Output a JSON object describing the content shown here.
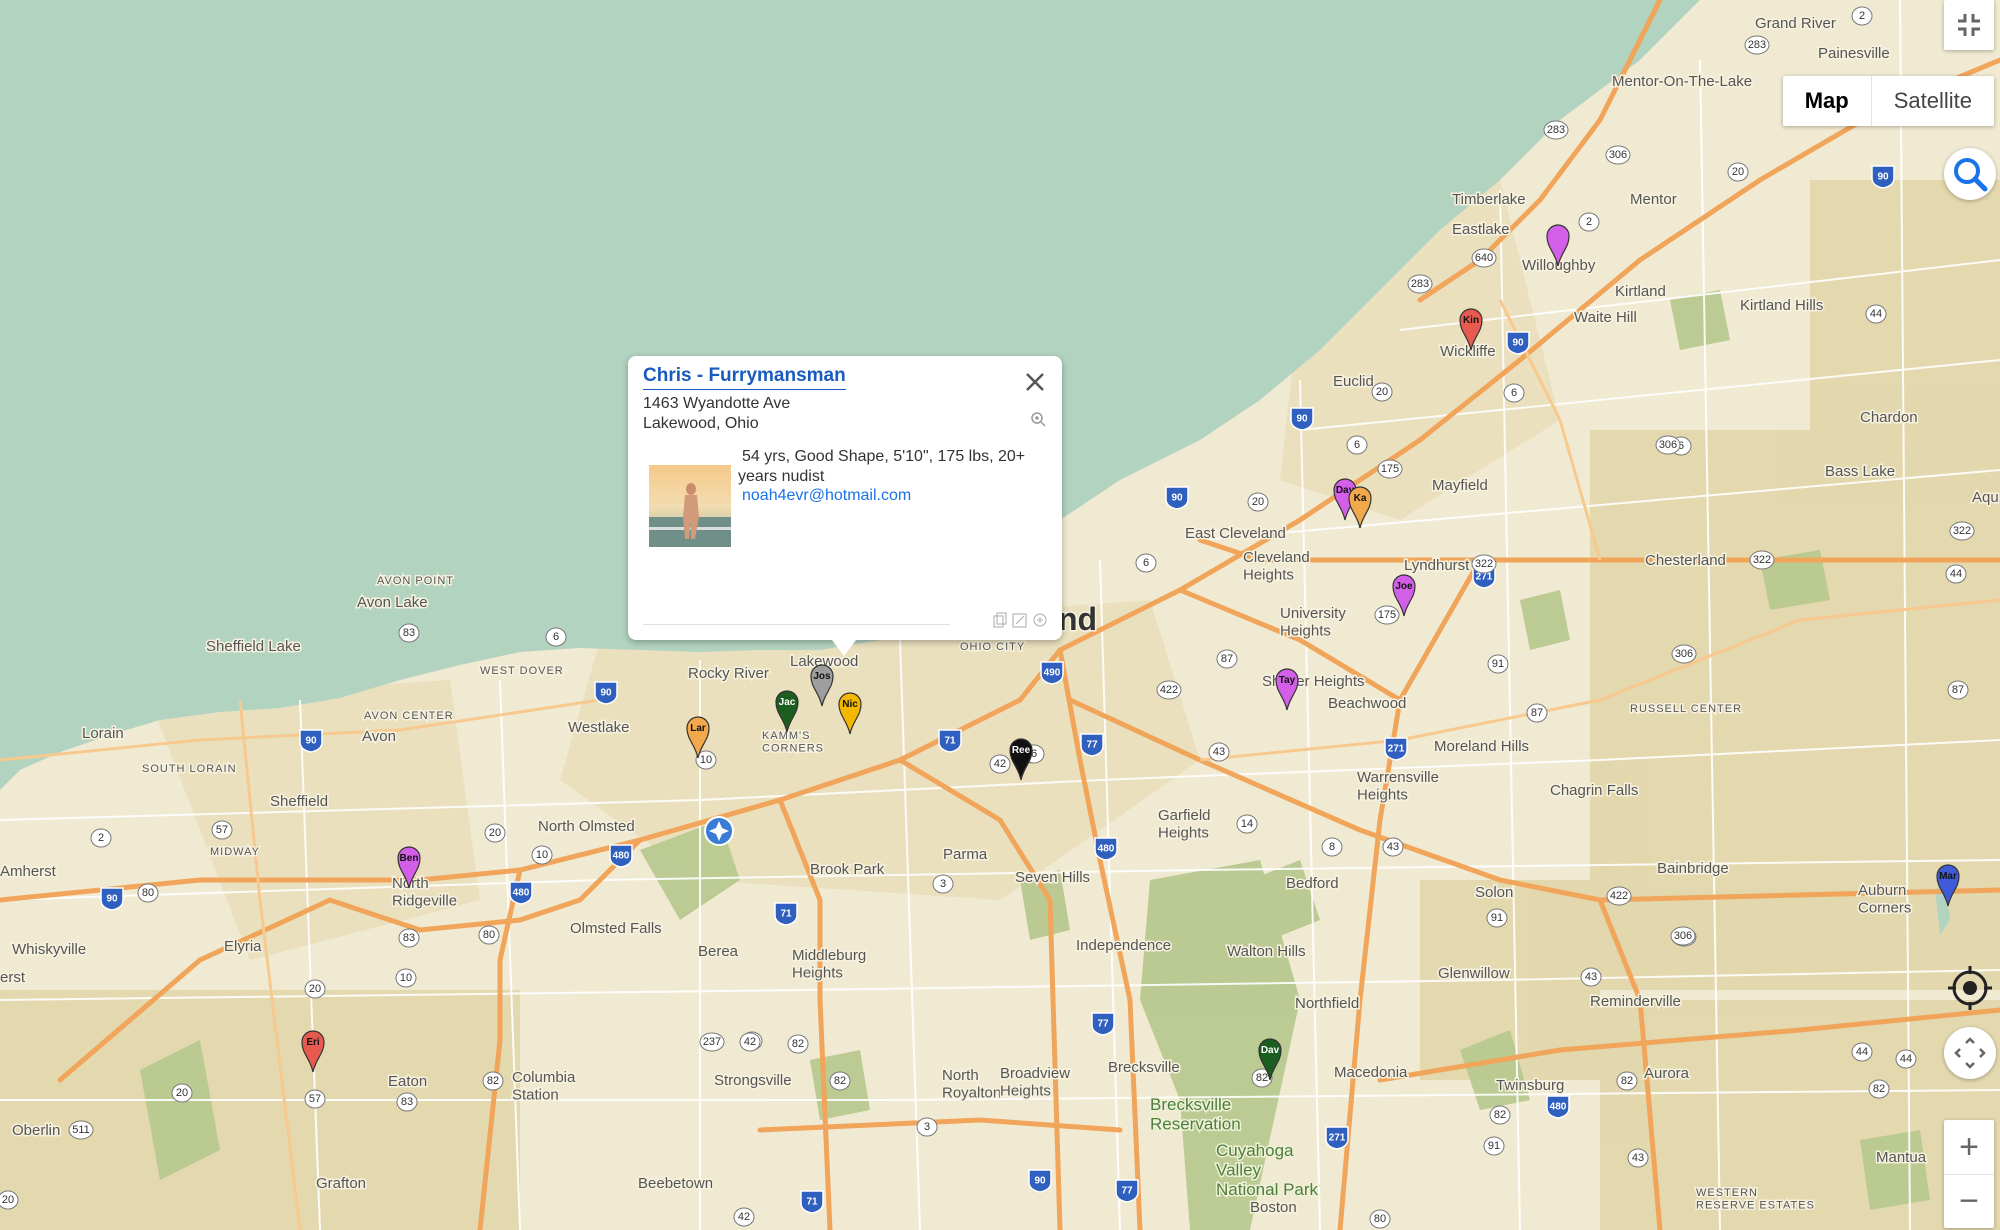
{
  "map": {
    "map_type_buttons": [
      "Map",
      "Satellite"
    ],
    "selected_map_type": "Map",
    "colors": {
      "water": "#b3d3c1",
      "land": "#f1ead2",
      "park": "#b5c98e",
      "urban": "#e4d8b0",
      "highway": "#f0a55a",
      "accent": "#1a73e8"
    },
    "places": {
      "grand_river": "Grand River",
      "painesville": "Painesville",
      "mentor_on_the_lake": "Mentor-On-The-Lake",
      "timberlake": "Timberlake",
      "mentor": "Mentor",
      "eastlake": "Eastlake",
      "willoughby": "Willoughby",
      "kirtland": "Kirtland",
      "waite_hill": "Waite Hill",
      "kirtland_hills": "Kirtland Hills",
      "wickliffe": "Wickliffe",
      "euclid": "Euclid",
      "chardon": "Chardon",
      "mayfield": "Mayfield",
      "bass_lake": "Bass Lake",
      "aqu": "Aqu",
      "east_cleveland": "East Cleveland",
      "cleveland_heights": "Cleveland\nHeights",
      "lyndhurst": "Lyndhurst",
      "chesterland": "Chesterland",
      "university_heights": "University\nHeights",
      "avon_point": "AVON POINT",
      "avon_lake": "Avon Lake",
      "sheffield_lake": "Sheffield Lake",
      "west_dover": "WEST DOVER",
      "rocky_river": "Rocky River",
      "lakewood": "Lakewood",
      "cleveland_tail": "nd",
      "ohio_city": "OHIO CITY",
      "shaker_heights": "Shaker Heights",
      "beachwood": "Beachwood",
      "russell_center": "RUSSELL CENTER",
      "avon_center": "AVON CENTER",
      "westlake": "Westlake",
      "kamms_corners": "KAMM'S\nCORNERS",
      "lorain": "Lorain",
      "avon": "Avon",
      "moreland_hills": "Moreland Hills",
      "south_lorain": "SOUTH LORAIN",
      "warrensville_heights": "Warrensville\nHeights",
      "sheffield": "Sheffield",
      "chagrin_falls": "Chagrin Falls",
      "north_olmsted": "North Olmsted",
      "garfield_heights": "Garfield\nHeights",
      "midway": "MIDWAY",
      "parma": "Parma",
      "amherst": "Amherst",
      "north_ridgeville": "North\nRidgeville",
      "brook_park": "Brook Park",
      "seven_hills": "Seven Hills",
      "bedford": "Bedford",
      "bainbridge": "Bainbridge",
      "solon": "Solon",
      "auburn_corners": "Auburn\nCorners",
      "olmsted_falls": "Olmsted Falls",
      "whiskyville": "Whiskyville",
      "elyria": "Elyria",
      "berea": "Berea",
      "middleburg_heights": "Middleburg\nHeights",
      "independence": "Independence",
      "walton_hills": "Walton Hills",
      "erst": "erst",
      "glenwillow": "Glenwillow",
      "reminderville": "Reminderville",
      "northfield": "Northfield",
      "eaton": "Eaton",
      "columbia_station": "Columbia\nStation",
      "strongsville": "Strongsville",
      "north_royalton": "North\nRoyalton",
      "broadview_heights": "Broadview\nHeights",
      "brecksville": "Brecksville",
      "brecksville_reservation": "Brecksville\nReservation",
      "macedonia": "Macedonia",
      "twinsburg": "Twinsburg",
      "aurora": "Aurora",
      "oberlin": "Oberlin",
      "cuyahoga_valley": "Cuyahoga\nValley\nNational Park",
      "grafton": "Grafton",
      "beebetown": "Beebetown",
      "boston": "Boston",
      "mantua": "Mantua",
      "western_reserve_estates": "WESTERN\nRESERVE ESTATES"
    },
    "route_shields": [
      "2",
      "283",
      "283",
      "306",
      "20",
      "90",
      "2",
      "640",
      "283",
      "90",
      "44",
      "20",
      "6",
      "90",
      "6",
      "6",
      "175",
      "306",
      "20",
      "90",
      "6",
      "322",
      "271",
      "322",
      "175",
      "87",
      "422",
      "322",
      "44",
      "306",
      "83",
      "6",
      "90",
      "490",
      "91",
      "87",
      "87",
      "6",
      "10",
      "71",
      "42",
      "77",
      "43",
      "271",
      "6",
      "90",
      "57",
      "2",
      "20",
      "10",
      "480",
      "480",
      "14",
      "8",
      "43",
      "422",
      "90",
      "80",
      "71",
      "3",
      "480",
      "91",
      "306",
      "83",
      "80",
      "10",
      "306",
      "43",
      "20",
      "237",
      "42",
      "82",
      "77",
      "44",
      "42",
      "82",
      "82",
      "57",
      "83",
      "82",
      "20",
      "511",
      "3",
      "91",
      "480",
      "82",
      "82",
      "44",
      "82",
      "90",
      "42",
      "71",
      "77",
      "80",
      "271",
      "43",
      "20"
    ],
    "pins": [
      {
        "label": "",
        "color": "#d35ee8"
      },
      {
        "label": "Kin",
        "color": "#e85a4f"
      },
      {
        "label": "Day",
        "color": "#d35ee8"
      },
      {
        "label": "Ka",
        "color": "#f2a94c"
      },
      {
        "label": "Joe",
        "color": "#d35ee8"
      },
      {
        "label": "Tay",
        "color": "#d35ee8"
      },
      {
        "label": "Jos",
        "color": "#9e9e9e"
      },
      {
        "label": "Jac",
        "color": "#1b5e20"
      },
      {
        "label": "Nic",
        "color": "#f5b800"
      },
      {
        "label": "Lar",
        "color": "#f2a94c"
      },
      {
        "label": "Ree",
        "color": "#111111"
      },
      {
        "label": "Ben",
        "color": "#d35ee8"
      },
      {
        "label": "Mar",
        "color": "#3f5bd9"
      },
      {
        "label": "Eri",
        "color": "#e85a4f"
      },
      {
        "label": "Dav",
        "color": "#1b5e20"
      }
    ]
  },
  "controls": {
    "fullscreen_icon": "fullscreen-exit-icon",
    "search_icon": "search-icon",
    "locate_icon": "my-location-icon",
    "pan_icon": "pan-arrows-icon",
    "zoom_in": "+",
    "zoom_out": "−"
  },
  "info_window": {
    "title": "Chris - Furrymansman",
    "address_line1": "1463 Wyandotte Ave",
    "address_line2": "Lakewood, Ohio",
    "description": "54 yrs, Good Shape, 5'10\", 175 lbs, 20+ years nudist",
    "email": "noah4evr@hotmail.com",
    "close_icon": "close-icon",
    "zoom_icon": "zoom-in-icon",
    "tool_icons": [
      "copy-icon",
      "edit-icon",
      "print-icon"
    ]
  }
}
